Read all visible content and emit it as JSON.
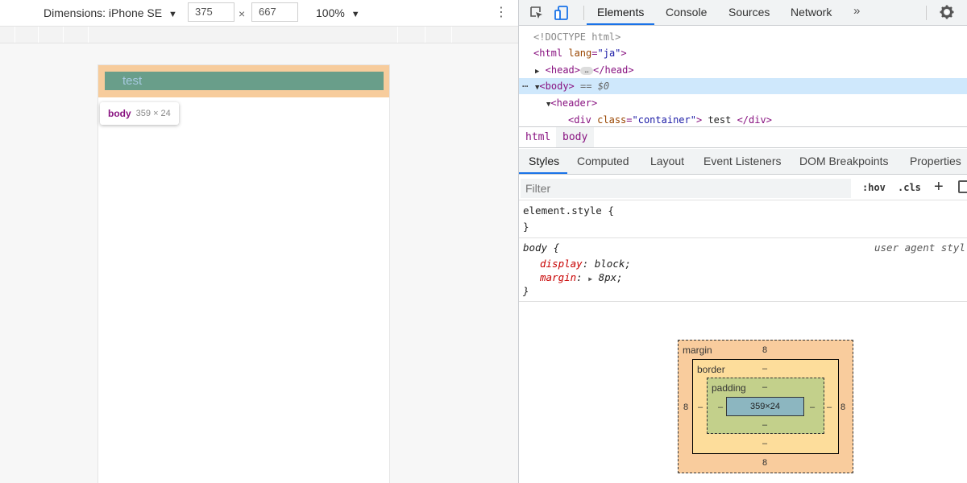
{
  "device_toolbar": {
    "dimensions_label": "Dimensions: iPhone SE",
    "width": "375",
    "times": "×",
    "height": "667",
    "zoom": "100%"
  },
  "page": {
    "header_text": "test",
    "tooltip_tag": "body",
    "tooltip_dims": "359 × 24"
  },
  "devtools": {
    "tabs": [
      "Elements",
      "Console",
      "Sources",
      "Network"
    ],
    "more": "»",
    "dom": {
      "doctype": "<!DOCTYPE html>",
      "html_open": "<html",
      "html_attr": "lang",
      "html_attr_val": "\"ja\"",
      "html_close": ">",
      "head_open": "<head>",
      "ellipsis": "…",
      "head_close": "</head>",
      "body_open": "<body>",
      "body_eq": "== $0",
      "header_open": "<header>",
      "div_open": "<div",
      "div_attr": "class",
      "div_attr_val": "\"container\"",
      "div_gt": ">",
      "div_text": " test ",
      "div_close": "</div>"
    },
    "breadcrumbs": [
      "html",
      "body"
    ],
    "subtabs": [
      "Styles",
      "Computed",
      "Layout",
      "Event Listeners",
      "DOM Breakpoints",
      "Properties"
    ],
    "filter_placeholder": "Filter",
    "hov": ":hov",
    "cls": ".cls",
    "plus": "+",
    "rules": {
      "element_style": "element.style {",
      "close_brace": "}",
      "body_selector": "body {",
      "source": "user agent styl",
      "prop1_name": "display",
      "prop1_value": "block;",
      "prop2_name": "margin",
      "prop2_value": "8px;"
    },
    "box_model": {
      "margin_label": "margin",
      "border_label": "border",
      "padding_label": "padding",
      "margin_top": "8",
      "margin_bottom": "8",
      "margin_left": "8",
      "margin_right": "8",
      "border_top": "–",
      "border_bottom": "–",
      "border_left": "–",
      "border_right": "–",
      "padding_top": "–",
      "padding_bottom": "–",
      "padding_left": "–",
      "padding_right": "–",
      "content": "359×24"
    }
  },
  "colors": {
    "margin_highlight": "#f7cc9c",
    "content_highlight": "#699e8a",
    "accent": "#1a73e8"
  },
  "icons": [
    "inspect-icon",
    "device-toggle-icon",
    "more-tabs-icon",
    "settings-gear-icon",
    "kebab-menu-icon"
  ]
}
